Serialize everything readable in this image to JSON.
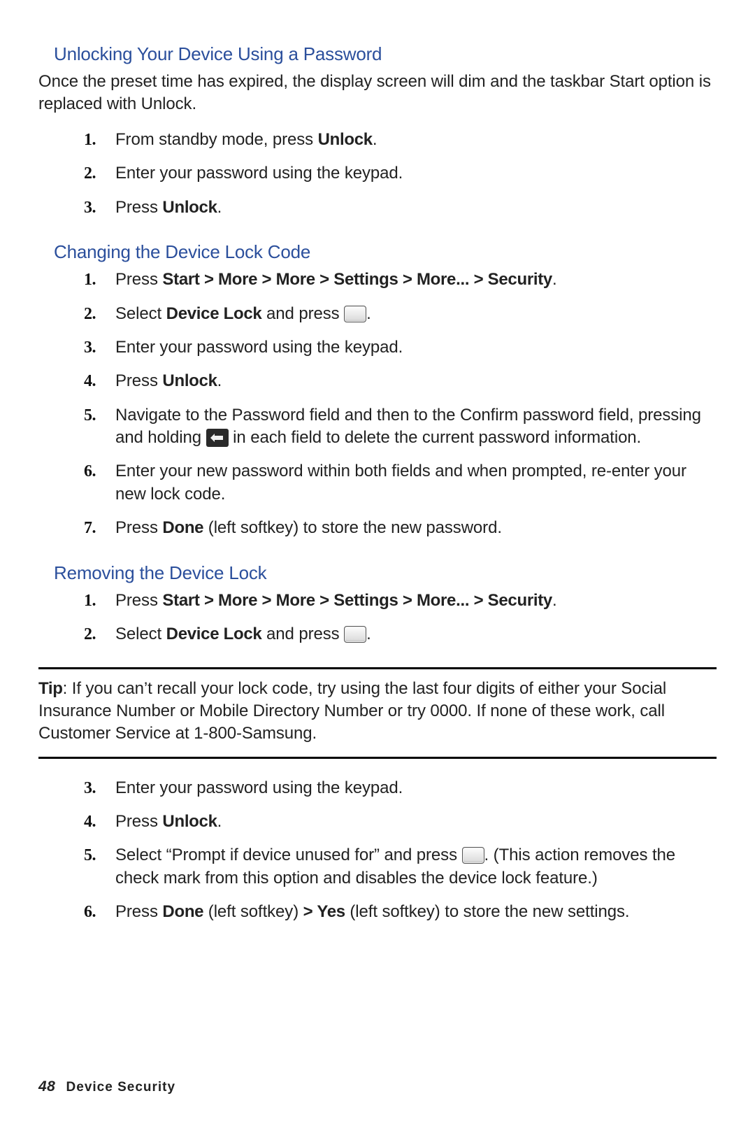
{
  "sections": {
    "s1": {
      "heading": "Unlocking Your Device Using a Password",
      "intro": "Once the preset time has expired, the display screen will dim and the taskbar Start option is replaced with Unlock.",
      "steps": {
        "n1": "1.",
        "t1a": "From standby mode, press ",
        "t1b": "Unlock",
        "t1c": ".",
        "n2": "2.",
        "t2": "Enter your password using the keypad.",
        "n3": "3.",
        "t3a": "Press ",
        "t3b": "Unlock",
        "t3c": "."
      }
    },
    "s2": {
      "heading": "Changing the Device Lock Code",
      "steps": {
        "n1": "1.",
        "t1a": "Press ",
        "t1b": "Start > More > More > Settings > More... > Security",
        "t1c": ".",
        "n2": "2.",
        "t2a": "Select ",
        "t2b": "Device Lock",
        "t2c": " and press ",
        "t2d": ".",
        "n3": "3.",
        "t3": "Enter your password using the keypad.",
        "n4": "4.",
        "t4a": "Press ",
        "t4b": "Unlock",
        "t4c": ".",
        "n5": "5.",
        "t5a": "Navigate to the Password field and then to the Confirm password field, pressing and holding ",
        "t5b": " in each field to delete the current password information.",
        "n6": "6.",
        "t6": "Enter your new password within both fields and when prompted, re-enter your new lock code.",
        "n7": "7.",
        "t7a": "Press ",
        "t7b": "Done",
        "t7c": " (left softkey) to store the new password."
      }
    },
    "s3": {
      "heading": "Removing the Device Lock",
      "steps_a": {
        "n1": "1.",
        "t1a": "Press ",
        "t1b": "Start > More > More > Settings > More... > Security",
        "t1c": ".",
        "n2": "2.",
        "t2a": "Select ",
        "t2b": "Device Lock",
        "t2c": " and press ",
        "t2d": "."
      },
      "steps_b": {
        "n3": "3.",
        "t3": "Enter your password using the keypad.",
        "n4": "4.",
        "t4a": "Press ",
        "t4b": "Unlock",
        "t4c": ".",
        "n5": "5.",
        "t5a": "Select “Prompt if device unused for” and press ",
        "t5b": ". (This action removes the check mark from this option and disables the device lock feature.)",
        "n6": "6.",
        "t6a": "Press ",
        "t6b": "Done",
        "t6c": " (left softkey) ",
        "t6d": "> Yes",
        "t6e": " (left softkey) to store the new settings."
      }
    }
  },
  "tip": {
    "label": "Tip",
    "body": ": If you can’t recall your lock code, try using the last four digits of either your Social Insurance Number or Mobile Directory Number or try 0000. If none of these work, call Customer Service at 1-800-Samsung."
  },
  "footer": {
    "page": "48",
    "section": "Device Security"
  }
}
